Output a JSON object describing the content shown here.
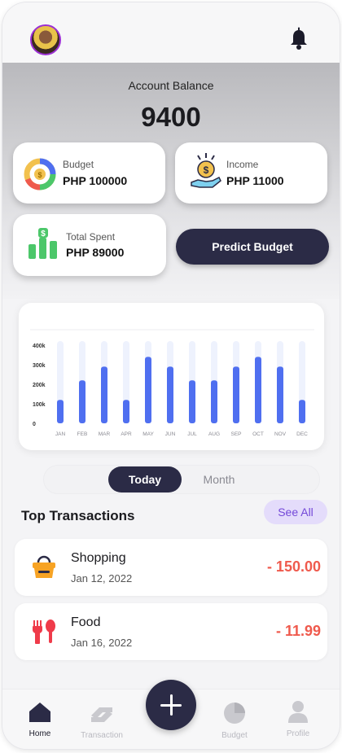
{
  "header": {
    "avatar": "user-avatar",
    "notification_icon": "bell-icon"
  },
  "balance": {
    "label": "Account Balance",
    "value": "9400"
  },
  "cards": {
    "budget": {
      "label": "Budget",
      "value": "PHP 100000",
      "icon": "donut-chart-icon"
    },
    "income": {
      "label": "Income",
      "value": "PHP 11000",
      "icon": "coin-hand-icon"
    },
    "spent": {
      "label": "Total Spent",
      "value": "PHP 89000",
      "icon": "bar-chart-money-icon"
    }
  },
  "predict_label": "Predict Budget",
  "chart_data": {
    "type": "bar",
    "categories": [
      "JAN",
      "FEB",
      "MAR",
      "APR",
      "MAY",
      "JUN",
      "JUL",
      "AUG",
      "SEP",
      "OCT",
      "NOV",
      "DEC"
    ],
    "values": [
      120,
      220,
      290,
      120,
      340,
      290,
      220,
      220,
      290,
      340,
      290,
      120
    ],
    "ylim": [
      0,
      400
    ],
    "ytick_labels": [
      "400k",
      "300k",
      "200k",
      "100k",
      "0"
    ],
    "yticks": [
      400,
      300,
      200,
      100,
      0
    ],
    "bar_color": "#4f6ff0",
    "track_color": "#eef2fd"
  },
  "segment": {
    "today": "Today",
    "month": "Month"
  },
  "transactions": {
    "title": "Top Transactions",
    "see_all": "See All",
    "items": [
      {
        "name": "Shopping",
        "date": "Jan 12, 2022",
        "amount": "- 150.00",
        "icon": "shopping-basket-icon"
      },
      {
        "name": "Food",
        "date": "Jan 16, 2022",
        "amount": "- 11.99",
        "icon": "fork-spoon-icon"
      }
    ]
  },
  "nav": {
    "home": "Home",
    "transaction": "Transaction",
    "budget": "Budget",
    "profile": "Profile"
  },
  "colors": {
    "primary": "#2b2b46",
    "accent_purple": "#7348d8",
    "expense_red": "#ef5a4d",
    "chart_blue": "#4f6ff0"
  }
}
